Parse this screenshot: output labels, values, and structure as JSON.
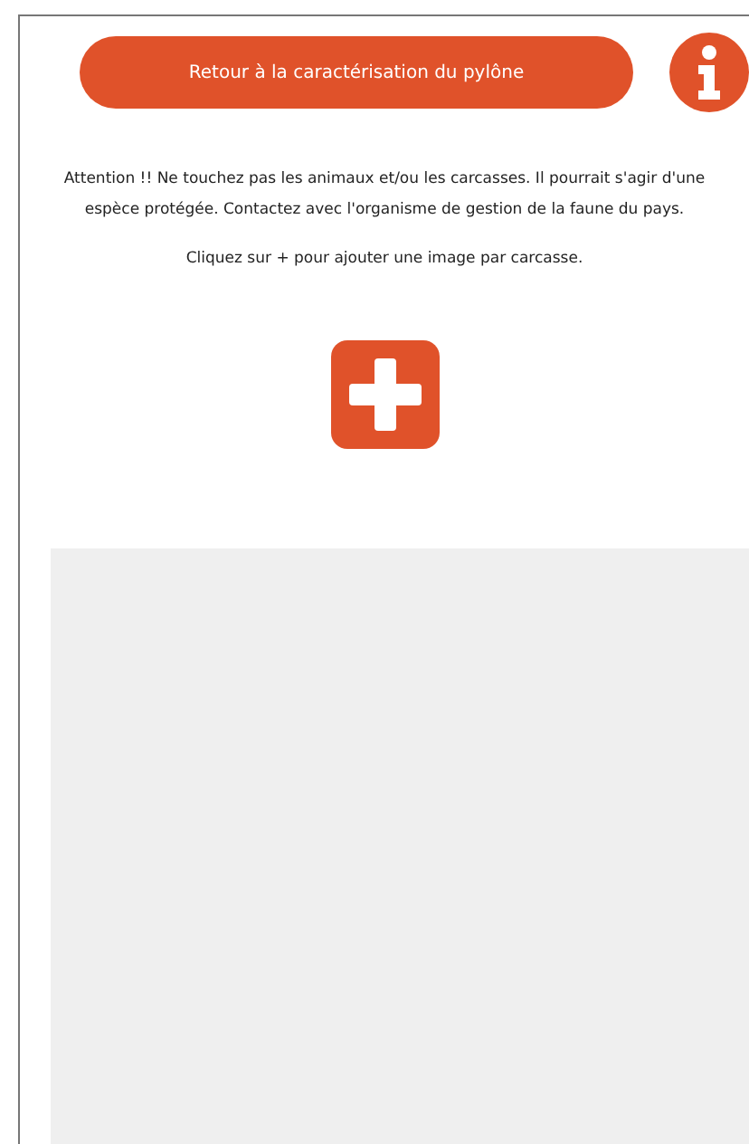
{
  "back_button": {
    "label": "Retour à la caractérisation du pylône"
  },
  "warning": "Attention !! Ne touchez pas les animaux et/ou les carcasses. Il pourrait s'agir d'une espèce protégée. Contactez avec l'organisme de gestion de la faune du pays.",
  "instruction": "Cliquez sur + pour ajouter une image par carcasse."
}
